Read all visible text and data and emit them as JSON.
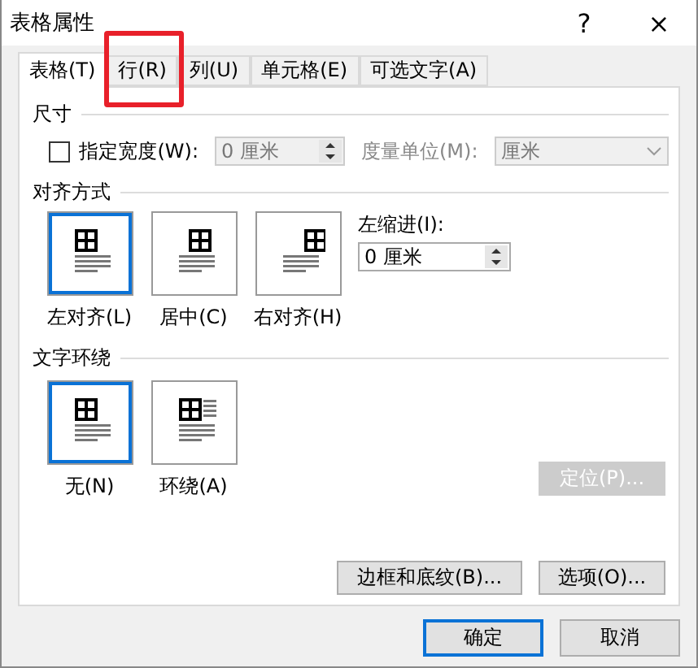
{
  "window": {
    "title": "表格属性",
    "help": "?",
    "close": "×"
  },
  "tabs": [
    {
      "label": "表格(T)",
      "selected": true,
      "highlighted": false
    },
    {
      "label": "行(R)",
      "selected": false,
      "highlighted": true
    },
    {
      "label": "列(U)",
      "selected": false,
      "highlighted": false
    },
    {
      "label": "单元格(E)",
      "selected": false,
      "highlighted": false
    },
    {
      "label": "可选文字(A)",
      "selected": false,
      "highlighted": false
    }
  ],
  "size": {
    "heading": "尺寸",
    "width_checkbox": {
      "label": "指定宽度(W):",
      "checked": false
    },
    "width_value": "0 厘米",
    "width_disabled": true,
    "unit_label": "度量单位(M):",
    "unit_value": "厘米",
    "unit_disabled": true
  },
  "alignment": {
    "heading": "对齐方式",
    "options": [
      {
        "label": "左对齐(L)",
        "kind": "left",
        "selected": true
      },
      {
        "label": "居中(C)",
        "kind": "center",
        "selected": false
      },
      {
        "label": "右对齐(H)",
        "kind": "right",
        "selected": false
      }
    ],
    "indent_label": "左缩进(I):",
    "indent_value": "0 厘米"
  },
  "wrapping": {
    "heading": "文字环绕",
    "options": [
      {
        "label": "无(N)",
        "kind": "none",
        "selected": true
      },
      {
        "label": "环绕(A)",
        "kind": "around",
        "selected": false
      }
    ],
    "position_button": {
      "label": "定位(P)...",
      "disabled": true
    }
  },
  "buttons": [
    {
      "label": "边框和底纹(B)..."
    },
    {
      "label": "选项(O)..."
    }
  ],
  "footer": [
    {
      "label": "确定",
      "default": true
    },
    {
      "label": "取消",
      "default": false
    }
  ]
}
